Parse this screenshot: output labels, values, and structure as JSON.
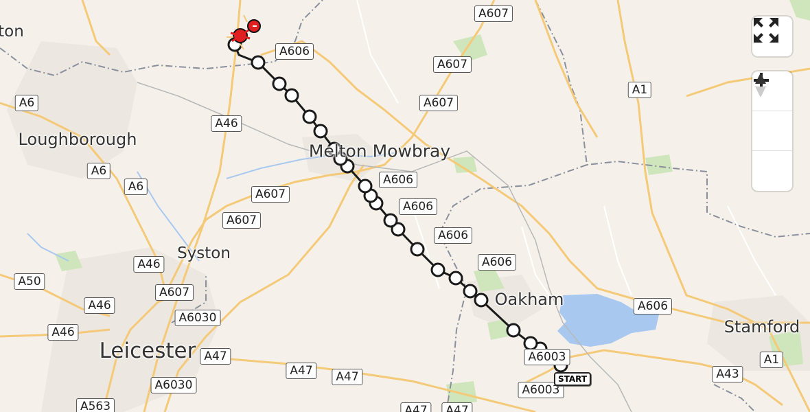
{
  "map": {
    "places": [
      {
        "id": "place-ashby",
        "name": "ton"
      },
      {
        "id": "place-loughborough",
        "name": "Loughborough"
      },
      {
        "id": "place-melton-mowbray",
        "name": "Melton Mowbray"
      },
      {
        "id": "place-syston",
        "name": "Syston"
      },
      {
        "id": "place-oakham",
        "name": "Oakham"
      },
      {
        "id": "place-leicester",
        "name": "Leicester"
      },
      {
        "id": "place-stamford",
        "name": "Stamford"
      }
    ],
    "road_labels": [
      "A607",
      "A606",
      "A607",
      "A607",
      "A1",
      "A6",
      "A46",
      "A6",
      "A6",
      "A606",
      "A607",
      "A606",
      "A607",
      "A606",
      "A46",
      "A606",
      "A50",
      "A607",
      "A46",
      "A6030",
      "A46",
      "A47",
      "A47",
      "A47",
      "A6003",
      "A6003",
      "A606",
      "A1",
      "A43",
      "A6030",
      "A563",
      "A47",
      "A47"
    ],
    "start_label": "START",
    "colors": {
      "background": "#f5f1ea",
      "road_major": "#f4c978",
      "route": "#1a1a1a",
      "water": "#a8c8f0",
      "park": "#cfe6bd",
      "boundary": "#8a8f9c",
      "urban": "#ece7e0",
      "marker": "#e02020"
    },
    "route": {
      "waypoint_count": 24,
      "start": "Oakham area",
      "end": "near A606 north-west of Melton Mowbray"
    }
  },
  "controls": {
    "fullscreen_icon": "expand-arrows-icon",
    "zoom_in_icon": "plus-icon",
    "zoom_out_icon": "minus-icon",
    "compass_icon": "north-arrow-icon"
  }
}
